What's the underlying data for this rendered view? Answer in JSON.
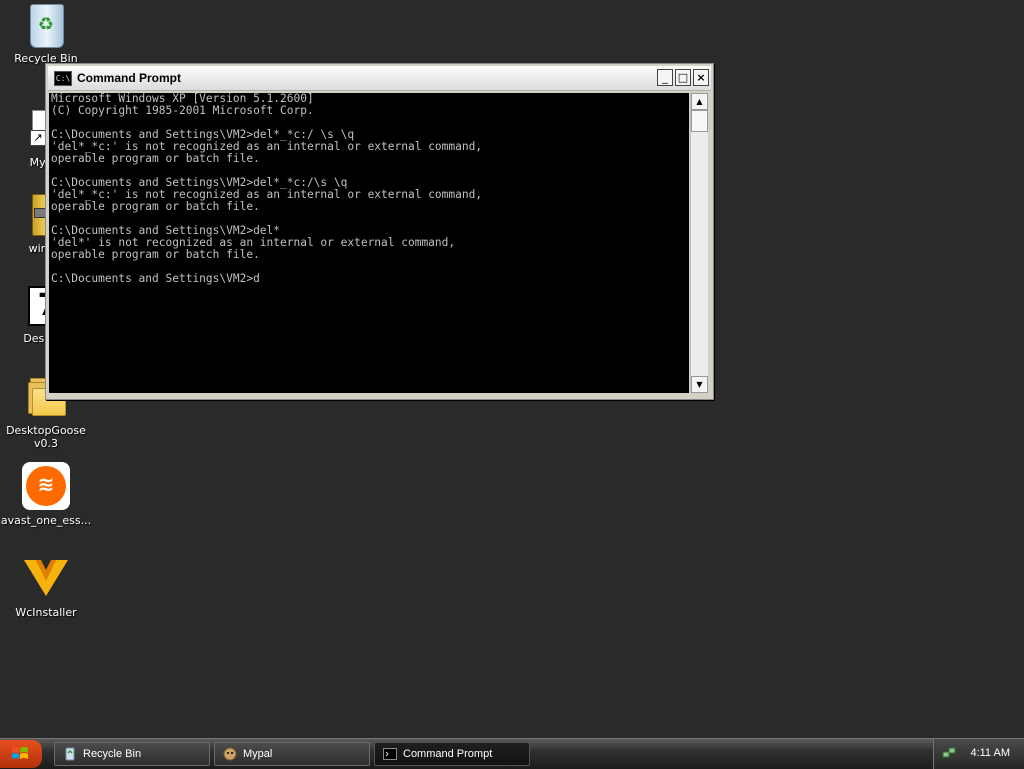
{
  "desktop": {
    "icons": [
      {
        "label": "Recycle Bin",
        "icon": "recycle-bin-icon"
      },
      {
        "label": "Mypal",
        "icon": "mypal-shortcut-icon"
      },
      {
        "label": "winzip",
        "icon": "winzip-icon"
      },
      {
        "label": "Desktop",
        "icon": "seven-icon"
      },
      {
        "label": "DesktopGoose\nv0.3",
        "icon": "folder-icon"
      },
      {
        "label": "avast_one_ess...",
        "icon": "avast-icon"
      },
      {
        "label": "WcInstaller",
        "icon": "wcinstaller-icon"
      }
    ]
  },
  "window": {
    "title": "Command Prompt",
    "icon_text": "C:\\",
    "minimize": "_",
    "maximize": "□",
    "close": "×",
    "lines": [
      "Microsoft Windows XP [Version 5.1.2600]",
      "(C) Copyright 1985-2001 Microsoft Corp.",
      "",
      "C:\\Documents and Settings\\VM2>del*_*c:/ \\s \\q",
      "'del*_*c:' is not recognized as an internal or external command,",
      "operable program or batch file.",
      "",
      "C:\\Documents and Settings\\VM2>del*_*c:/\\s \\q",
      "'del*_*c:' is not recognized as an internal or external command,",
      "operable program or batch file.",
      "",
      "C:\\Documents and Settings\\VM2>del*",
      "'del*' is not recognized as an internal or external command,",
      "operable program or batch file.",
      "",
      "C:\\Documents and Settings\\VM2>d"
    ],
    "scroll_up": "▲",
    "scroll_down": "▼"
  },
  "taskbar": {
    "buttons": [
      {
        "label": "Recycle Bin",
        "active": false
      },
      {
        "label": "Mypal",
        "active": false
      },
      {
        "label": "Command Prompt",
        "active": true
      }
    ],
    "clock": "4:11 AM"
  }
}
